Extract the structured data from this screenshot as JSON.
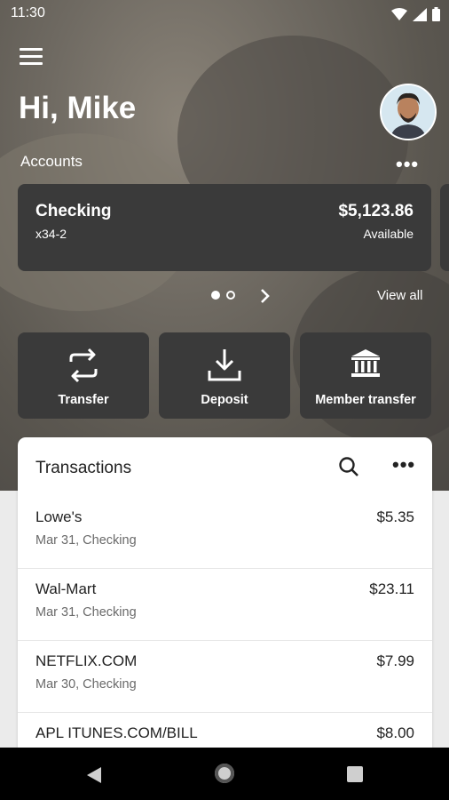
{
  "status_bar": {
    "time": "11:30"
  },
  "header": {
    "greeting": "Hi, Mike"
  },
  "accounts": {
    "label": "Accounts",
    "cards": [
      {
        "name": "Checking",
        "number": "x34-2",
        "balance": "$5,123.86",
        "balance_label": "Available"
      }
    ],
    "view_all": "View all"
  },
  "actions": [
    {
      "label": "Transfer",
      "icon": "transfer-icon"
    },
    {
      "label": "Deposit",
      "icon": "deposit-icon"
    },
    {
      "label": "Member transfer",
      "icon": "bank-icon"
    }
  ],
  "transactions": {
    "title": "Transactions",
    "items": [
      {
        "merchant": "Lowe's",
        "meta": "Mar 31, Checking",
        "amount": "$5.35"
      },
      {
        "merchant": "Wal-Mart",
        "meta": "Mar 31, Checking",
        "amount": "$23.11"
      },
      {
        "merchant": "NETFLIX.COM",
        "meta": "Mar 30, Checking",
        "amount": "$7.99"
      },
      {
        "merchant": "APL ITUNES.COM/BILL",
        "meta": "",
        "amount": "$8.00"
      }
    ]
  },
  "colors": {
    "card_bg": "#3a3a3a",
    "nav_bg": "#000000",
    "page_bg": "#ebebeb"
  }
}
